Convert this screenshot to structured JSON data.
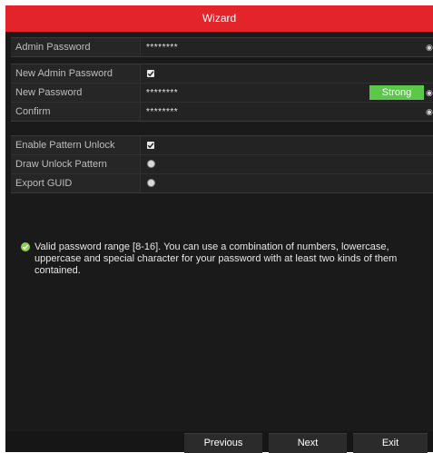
{
  "window": {
    "title": "Wizard"
  },
  "fields": {
    "admin_password": {
      "label": "Admin Password",
      "value": "********"
    },
    "new_admin_password": {
      "label": "New Admin Password",
      "checked": true
    },
    "new_password": {
      "label": "New Password",
      "value": "********",
      "strength": "Strong"
    },
    "confirm": {
      "label": "Confirm",
      "value": "********"
    }
  },
  "options": {
    "enable_pattern_unlock": {
      "label": "Enable Pattern Unlock",
      "checked": true
    },
    "draw_unlock_pattern": {
      "label": "Draw Unlock Pattern"
    },
    "export_guid": {
      "label": "Export GUID"
    }
  },
  "notice": {
    "text": "Valid password range [8-16]. You can use a combination of numbers, lowercase, uppercase and special character for your password with at least two kinds of them contained."
  },
  "footer": {
    "previous_label": "Previous",
    "next_label": "Next",
    "exit_label": "Exit"
  },
  "colors": {
    "title_bar": "#e3242b",
    "strength_strong": "#5bc84a",
    "ok_icon": "#8ccf52"
  }
}
